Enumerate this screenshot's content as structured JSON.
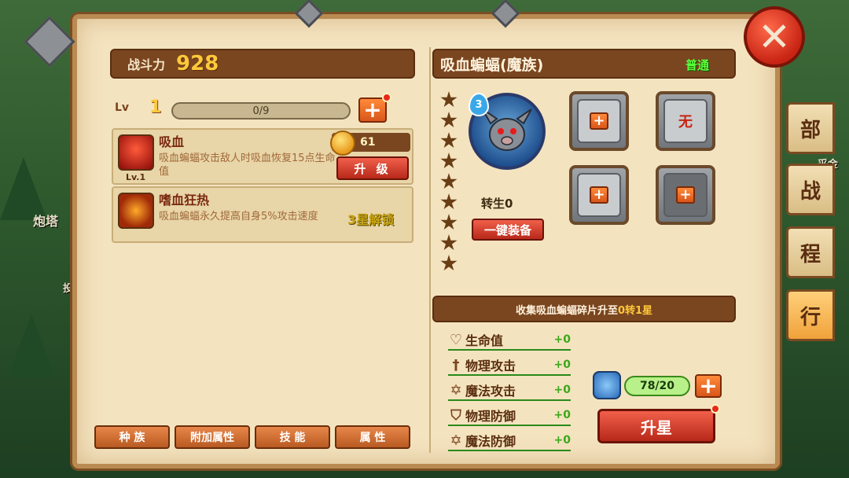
{
  "background": {
    "map_labels": [
      "炮塔",
      "投"
    ],
    "side_tabs": [
      "部",
      "战",
      "程",
      "行"
    ],
    "side_note": "采金"
  },
  "power": {
    "label": "战斗力",
    "value": "928"
  },
  "level": {
    "label": "Lv",
    "value": "1",
    "xp_text": "0/9"
  },
  "skills": [
    {
      "name": "吸血",
      "desc": "吸血蝙蝠攻击敌人时吸血恢复15点生命值",
      "level": "Lv.1",
      "cost": "61",
      "upgrade_label": "升 级"
    },
    {
      "name": "嗜血狂热",
      "desc": "吸血蝙蝠永久提高自身5%攻击速度",
      "unlock_text": "3星解锁"
    }
  ],
  "bottom_tabs": [
    "种 族",
    "附加属性",
    "技 能",
    "属 性"
  ],
  "hero": {
    "title": "吸血蝙蝠(魔族)",
    "quality": "普通",
    "drop_level": "3",
    "rebirth": "转生0",
    "equip_all_label": "一键装备",
    "empty_slot_label": "无",
    "collect_text_before": "收集吸血蝙蝠碎片升至",
    "collect_text_highlight": "0转1星",
    "shards": "78/20",
    "star_up_label": "升星"
  },
  "stats": [
    {
      "icon": "heart-icon",
      "label": "生命值",
      "value": "+0"
    },
    {
      "icon": "sword-icon",
      "label": "物理攻击",
      "value": "+0"
    },
    {
      "icon": "star-of-david-icon",
      "label": "魔法攻击",
      "value": "+0"
    },
    {
      "icon": "shield-icon",
      "label": "物理防御",
      "value": "+0"
    },
    {
      "icon": "hexagram-circle-icon",
      "label": "魔法防御",
      "value": "+0"
    }
  ],
  "colors": {
    "parchment": "#f4e3bf",
    "header_brown": "#7a4620",
    "accent_gold": "#ffc93a",
    "button_red": "#b8281a",
    "quality_green": "#5aff3a"
  }
}
